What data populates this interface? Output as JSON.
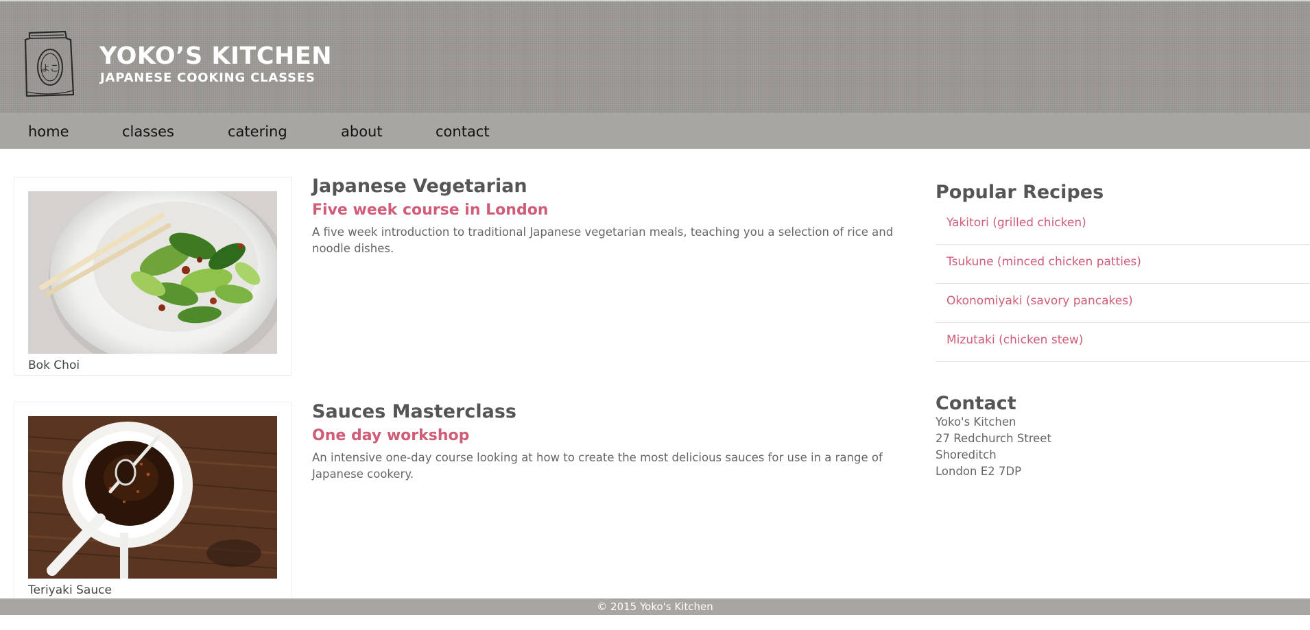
{
  "brand": {
    "title": "YOKO’S KITCHEN",
    "subtitle": "JAPANESE COOKING CLASSES",
    "logo_glyphs": "よこ",
    "logo_icon": "rice-bag-logo-icon"
  },
  "nav": {
    "items": [
      {
        "label": "home"
      },
      {
        "label": "classes"
      },
      {
        "label": "catering"
      },
      {
        "label": "about"
      },
      {
        "label": "contact"
      }
    ]
  },
  "courses": [
    {
      "image_caption": "Bok Choi",
      "image_icon": "bok-choi-photo",
      "title": "Japanese Vegetarian",
      "subtitle": "Five week course in London",
      "description": "A five week introduction to traditional Japanese vegetarian meals, teaching you a selection of rice and noodle dishes."
    },
    {
      "image_caption": "Teriyaki Sauce",
      "image_icon": "teriyaki-sauce-photo",
      "title": "Sauces Masterclass",
      "subtitle": "One day workshop",
      "description": "An intensive one-day course looking at how to create the most delicious sauces for use in a range of Japanese cookery."
    }
  ],
  "sidebar": {
    "recipes_heading": "Popular Recipes",
    "recipes": [
      {
        "label": "Yakitori (grilled chicken)"
      },
      {
        "label": "Tsukune (minced chicken patties)"
      },
      {
        "label": "Okonomiyaki (savory pancakes)"
      },
      {
        "label": "Mizutaki (chicken stew)"
      }
    ],
    "contact_heading": "Contact",
    "contact_lines": [
      "Yoko's Kitchen",
      "27 Redchurch Street",
      "Shoreditch",
      "London E2 7DP"
    ]
  },
  "footer": {
    "text": "© 2015 Yoko's Kitchen"
  },
  "colors": {
    "header_bg": "#9a9792",
    "nav_bg": "#a8a6a1",
    "accent": "#d05c78",
    "heading_text": "#555555",
    "body_text": "#666666"
  }
}
